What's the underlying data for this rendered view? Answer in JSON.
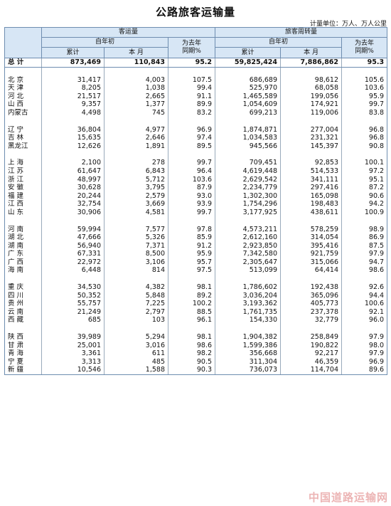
{
  "title": "公路旅客运输量",
  "unit_note": "计量单位：万人、万人公里",
  "headers": {
    "passenger_volume": "客运量",
    "passenger_turnover": "旅客周转量",
    "ytd_line1": "自年初",
    "ytd_line2": "累计",
    "month": "本 月",
    "yoy_line1": "为去年",
    "yoy_line2": "同期%"
  },
  "rows": [
    {
      "name": "总 计",
      "v_ytd": "873,469",
      "v_month": "110,843",
      "v_yoy": "95.2",
      "t_ytd": "59,825,424",
      "t_month": "7,886,862",
      "t_yoy": "95.3",
      "total": true
    },
    {
      "gap": true
    },
    {
      "name": "北 京",
      "v_ytd": "31,417",
      "v_month": "4,003",
      "v_yoy": "107.5",
      "t_ytd": "686,689",
      "t_month": "98,612",
      "t_yoy": "105.6"
    },
    {
      "name": "天 津",
      "v_ytd": "8,205",
      "v_month": "1,038",
      "v_yoy": "99.4",
      "t_ytd": "525,970",
      "t_month": "68,058",
      "t_yoy": "103.6"
    },
    {
      "name": "河 北",
      "v_ytd": "21,517",
      "v_month": "2,665",
      "v_yoy": "91.1",
      "t_ytd": "1,465,589",
      "t_month": "199,056",
      "t_yoy": "95.9"
    },
    {
      "name": "山 西",
      "v_ytd": "9,357",
      "v_month": "1,377",
      "v_yoy": "89.9",
      "t_ytd": "1,054,609",
      "t_month": "174,921",
      "t_yoy": "99.7"
    },
    {
      "name": "内蒙古",
      "v_ytd": "4,498",
      "v_month": "745",
      "v_yoy": "83.2",
      "t_ytd": "699,213",
      "t_month": "119,006",
      "t_yoy": "83.8"
    },
    {
      "gap": true
    },
    {
      "name": "辽 宁",
      "v_ytd": "36,804",
      "v_month": "4,977",
      "v_yoy": "96.9",
      "t_ytd": "1,874,871",
      "t_month": "277,004",
      "t_yoy": "96.8"
    },
    {
      "name": "吉 林",
      "v_ytd": "15,635",
      "v_month": "2,646",
      "v_yoy": "97.4",
      "t_ytd": "1,034,583",
      "t_month": "231,321",
      "t_yoy": "96.8"
    },
    {
      "name": "黑龙江",
      "v_ytd": "12,626",
      "v_month": "1,891",
      "v_yoy": "89.5",
      "t_ytd": "945,566",
      "t_month": "145,397",
      "t_yoy": "90.8"
    },
    {
      "gap": true
    },
    {
      "name": "上 海",
      "v_ytd": "2,100",
      "v_month": "278",
      "v_yoy": "99.7",
      "t_ytd": "709,451",
      "t_month": "92,853",
      "t_yoy": "100.1"
    },
    {
      "name": "江 苏",
      "v_ytd": "61,647",
      "v_month": "6,843",
      "v_yoy": "96.4",
      "t_ytd": "4,619,448",
      "t_month": "514,533",
      "t_yoy": "97.2"
    },
    {
      "name": "浙 江",
      "v_ytd": "48,997",
      "v_month": "5,712",
      "v_yoy": "103.6",
      "t_ytd": "2,629,542",
      "t_month": "341,111",
      "t_yoy": "95.1"
    },
    {
      "name": "安 徽",
      "v_ytd": "30,628",
      "v_month": "3,795",
      "v_yoy": "87.9",
      "t_ytd": "2,234,779",
      "t_month": "297,416",
      "t_yoy": "87.2"
    },
    {
      "name": "福 建",
      "v_ytd": "20,244",
      "v_month": "2,579",
      "v_yoy": "93.0",
      "t_ytd": "1,302,300",
      "t_month": "165,098",
      "t_yoy": "90.6"
    },
    {
      "name": "江 西",
      "v_ytd": "32,754",
      "v_month": "3,669",
      "v_yoy": "93.9",
      "t_ytd": "1,754,296",
      "t_month": "198,483",
      "t_yoy": "94.2"
    },
    {
      "name": "山 东",
      "v_ytd": "30,906",
      "v_month": "4,581",
      "v_yoy": "99.7",
      "t_ytd": "3,177,925",
      "t_month": "438,611",
      "t_yoy": "100.9"
    },
    {
      "gap": true
    },
    {
      "name": "河 南",
      "v_ytd": "59,994",
      "v_month": "7,577",
      "v_yoy": "97.8",
      "t_ytd": "4,573,211",
      "t_month": "578,259",
      "t_yoy": "98.9"
    },
    {
      "name": "湖 北",
      "v_ytd": "47,666",
      "v_month": "5,326",
      "v_yoy": "85.9",
      "t_ytd": "2,612,160",
      "t_month": "314,054",
      "t_yoy": "86.9"
    },
    {
      "name": "湖 南",
      "v_ytd": "56,940",
      "v_month": "7,371",
      "v_yoy": "91.2",
      "t_ytd": "2,923,850",
      "t_month": "395,416",
      "t_yoy": "87.5"
    },
    {
      "name": "广 东",
      "v_ytd": "67,331",
      "v_month": "8,500",
      "v_yoy": "95.9",
      "t_ytd": "7,342,580",
      "t_month": "921,759",
      "t_yoy": "97.9"
    },
    {
      "name": "广 西",
      "v_ytd": "22,972",
      "v_month": "3,106",
      "v_yoy": "95.7",
      "t_ytd": "2,305,647",
      "t_month": "315,066",
      "t_yoy": "94.7"
    },
    {
      "name": "海 南",
      "v_ytd": "6,448",
      "v_month": "814",
      "v_yoy": "97.5",
      "t_ytd": "513,099",
      "t_month": "64,414",
      "t_yoy": "98.6"
    },
    {
      "gap": true
    },
    {
      "name": "重 庆",
      "v_ytd": "34,530",
      "v_month": "4,382",
      "v_yoy": "98.1",
      "t_ytd": "1,786,602",
      "t_month": "192,438",
      "t_yoy": "92.6"
    },
    {
      "name": "四 川",
      "v_ytd": "50,352",
      "v_month": "5,848",
      "v_yoy": "89.2",
      "t_ytd": "3,036,204",
      "t_month": "365,096",
      "t_yoy": "94.4"
    },
    {
      "name": "贵 州",
      "v_ytd": "55,757",
      "v_month": "7,225",
      "v_yoy": "100.2",
      "t_ytd": "3,193,362",
      "t_month": "405,773",
      "t_yoy": "100.6"
    },
    {
      "name": "云 南",
      "v_ytd": "21,249",
      "v_month": "2,797",
      "v_yoy": "88.5",
      "t_ytd": "1,761,735",
      "t_month": "237,378",
      "t_yoy": "92.1"
    },
    {
      "name": "西 藏",
      "v_ytd": "685",
      "v_month": "103",
      "v_yoy": "96.1",
      "t_ytd": "154,330",
      "t_month": "32,779",
      "t_yoy": "96.0"
    },
    {
      "gap": true
    },
    {
      "name": "陕 西",
      "v_ytd": "39,989",
      "v_month": "5,294",
      "v_yoy": "98.1",
      "t_ytd": "1,904,382",
      "t_month": "258,849",
      "t_yoy": "97.9"
    },
    {
      "name": "甘 肃",
      "v_ytd": "25,001",
      "v_month": "3,016",
      "v_yoy": "98.6",
      "t_ytd": "1,599,386",
      "t_month": "190,822",
      "t_yoy": "98.0"
    },
    {
      "name": "青 海",
      "v_ytd": "3,361",
      "v_month": "611",
      "v_yoy": "98.2",
      "t_ytd": "356,668",
      "t_month": "92,217",
      "t_yoy": "97.9"
    },
    {
      "name": "宁 夏",
      "v_ytd": "3,313",
      "v_month": "485",
      "v_yoy": "90.5",
      "t_ytd": "311,304",
      "t_month": "46,359",
      "t_yoy": "96.9"
    },
    {
      "name": "新 疆",
      "v_ytd": "10,546",
      "v_month": "1,588",
      "v_yoy": "90.3",
      "t_ytd": "736,073",
      "t_month": "114,704",
      "t_yoy": "89.6"
    }
  ],
  "watermark": "中国道路运输网"
}
